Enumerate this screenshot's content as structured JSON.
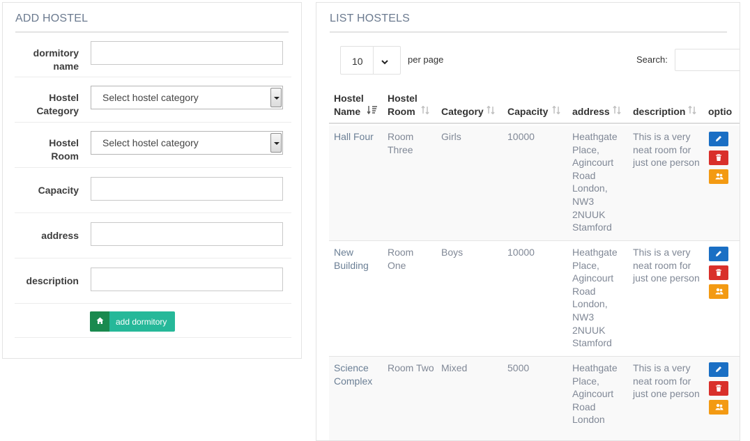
{
  "add_panel": {
    "title": "ADD HOSTEL",
    "fields": [
      {
        "label_line1": "dormitory",
        "label_line2": "name",
        "type": "input",
        "value": ""
      },
      {
        "label_line1": "Hostel",
        "label_line2": "Category",
        "type": "select",
        "value": "Select hostel category"
      },
      {
        "label_line1": "Hostel",
        "label_line2": "Room",
        "type": "select",
        "value": "Select hostel category"
      },
      {
        "label_line1": "Capacity",
        "label_line2": "",
        "type": "input",
        "value": ""
      },
      {
        "label_line1": "address",
        "label_line2": "",
        "type": "input",
        "value": ""
      },
      {
        "label_line1": "description",
        "label_line2": "",
        "type": "input",
        "value": ""
      }
    ],
    "submit_label": "add dormitory"
  },
  "list_panel": {
    "title": "LIST HOSTELS",
    "page_length": "10",
    "per_page_label": "per page",
    "search_label": "Search:",
    "columns": [
      {
        "line1": "Hostel",
        "line2": "Name"
      },
      {
        "line1": "Hostel",
        "line2": "Room"
      },
      {
        "line1": "",
        "line2": "Category"
      },
      {
        "line1": "",
        "line2": "Capacity"
      },
      {
        "line1": "",
        "line2": "address"
      },
      {
        "line1": "",
        "line2": "description"
      },
      {
        "line1": "",
        "line2": "optio"
      }
    ],
    "rows": [
      {
        "name": [
          "Hall Four"
        ],
        "room": [
          "Room",
          "Three"
        ],
        "category": "Girls",
        "capacity": "10000",
        "address": [
          "Heathgate",
          "Place,",
          "Agincourt",
          "Road",
          "London,",
          "NW3",
          "2NUUK",
          "Stamford"
        ],
        "description": [
          "This is a very",
          "neat room for",
          "just one person"
        ]
      },
      {
        "name": [
          "New",
          "Building"
        ],
        "room": [
          "Room",
          "One"
        ],
        "category": "Boys",
        "capacity": "10000",
        "address": [
          "Heathgate",
          "Place,",
          "Agincourt",
          "Road",
          "London,",
          "NW3",
          "2NUUK",
          "Stamford"
        ],
        "description": [
          "This is a very",
          "neat room for",
          "just one person"
        ]
      },
      {
        "name": [
          "Science",
          "Complex"
        ],
        "room": [
          "Room Two"
        ],
        "category": "Mixed",
        "capacity": "5000",
        "address": [
          "Heathgate",
          "Place,",
          "Agincourt",
          "Road",
          "London"
        ],
        "description": [
          "This is a very",
          "neat room for",
          "just one person"
        ]
      }
    ]
  },
  "colors": {
    "title": "#6b7a8f",
    "button_primary": "#26b899",
    "button_icon": "#1a8a4f",
    "edit": "#1a6fc4",
    "delete": "#d9302b",
    "users": "#f39a13"
  },
  "icons": {
    "submit": "home-icon",
    "length_arrow": "chevron-down-icon",
    "row_actions": [
      "pencil-icon",
      "trash-icon",
      "users-icon"
    ]
  }
}
